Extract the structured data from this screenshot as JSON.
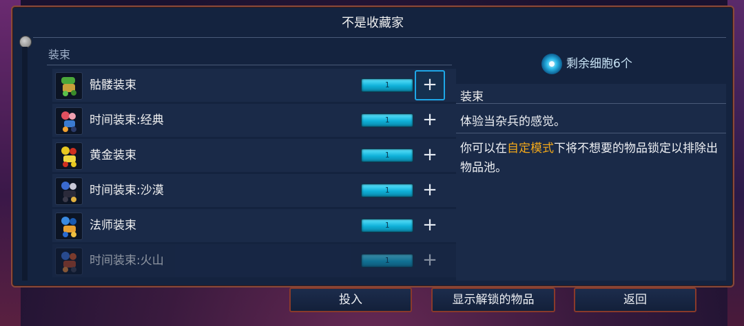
{
  "window": {
    "title": "不是收藏家"
  },
  "section": {
    "label": "装束"
  },
  "cells": {
    "text": "剩余细胞6个"
  },
  "items": [
    {
      "name": "骷髅装束",
      "count": "1",
      "icon": "skeleton-outfit-icon",
      "colors": [
        "#4aa83a",
        "#c8a03a"
      ]
    },
    {
      "name": "时间装束:经典",
      "count": "1",
      "icon": "time-outfit-classic-icon",
      "colors": [
        "#e05060",
        "#3a7ad0"
      ]
    },
    {
      "name": "黄金装束",
      "count": "1",
      "icon": "gold-outfit-icon",
      "colors": [
        "#e8c820",
        "#d03020"
      ]
    },
    {
      "name": "时间装束:沙漠",
      "count": "1",
      "icon": "time-outfit-desert-icon",
      "colors": [
        "#3a6ad0",
        "#2a2a3a"
      ]
    },
    {
      "name": "法师装束",
      "count": "1",
      "icon": "mage-outfit-icon",
      "colors": [
        "#3a8ae0",
        "#e8a030"
      ]
    },
    {
      "name": "时间装束:火山",
      "count": "1",
      "icon": "time-outfit-volcano-icon",
      "colors": [
        "#3a6ad0",
        "#d05020"
      ]
    }
  ],
  "detail": {
    "title": "装束",
    "desc": "体验当杂兵的感觉。",
    "note_before": "你可以在",
    "note_highlight": "自定模式",
    "note_after": "下将不想要的物品锁定以排除出物品池。"
  },
  "buttons": {
    "invest": "投入",
    "show_unlocked": "显示解锁的物品",
    "back": "返回"
  },
  "colors": {
    "accent": "#1ea8e8",
    "bar": "#22c4e8",
    "highlight": "#f2a81a",
    "border": "#8a3a2a"
  }
}
